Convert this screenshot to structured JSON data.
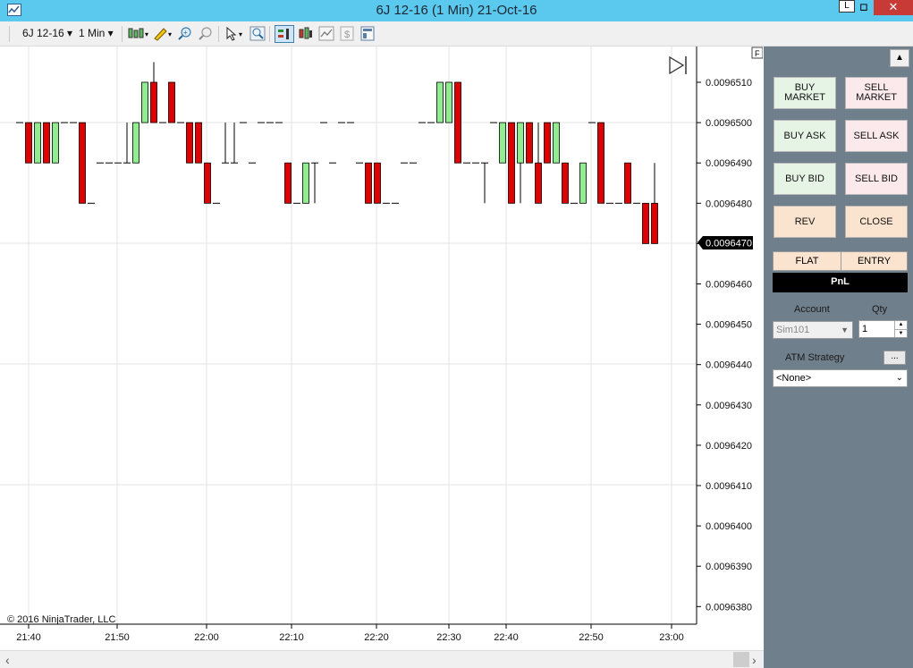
{
  "window": {
    "title": "6J 12-16 (1 Min)  21-Oct-16",
    "l_button": "L",
    "max_button": "◻",
    "close_button": "✕"
  },
  "toolbar": {
    "instrument": "6J 12-16",
    "interval": "1 Min"
  },
  "chart": {
    "copyright": "© 2016 NinjaTrader, LLC",
    "f_button": "F",
    "last_price_label": "0.0096470",
    "price_labels": [
      "0.0096510",
      "0.0096500",
      "0.0096490",
      "0.0096480",
      "0.0096470",
      "0.0096460",
      "0.0096450",
      "0.0096440",
      "0.0096430",
      "0.0096420",
      "0.0096410",
      "0.0096400",
      "0.0096390",
      "0.0096380"
    ],
    "time_labels": [
      "21:40",
      "21:50",
      "22:00",
      "22:10",
      "22:20",
      "22:30",
      "22:40",
      "22:50",
      "23:00"
    ]
  },
  "chart_data": {
    "type": "candlestick",
    "x_start": "21:40",
    "x_end": "23:00",
    "ylim": [
      0.0096378,
      0.0096516
    ],
    "colors": {
      "up": "#90ee90",
      "down": "#e00000",
      "wick": "#000000",
      "grid": "#e3e3e3"
    },
    "candles": [
      [
        "21:39",
        0.00965,
        0.00965,
        0.00965,
        0.00965
      ],
      [
        "21:40",
        0.00965,
        0.00965,
        0.009649,
        0.009649
      ],
      [
        "21:41",
        0.009649,
        0.00965,
        0.009649,
        0.00965
      ],
      [
        "21:42",
        0.00965,
        0.00965,
        0.009649,
        0.009649
      ],
      [
        "21:43",
        0.009649,
        0.00965,
        0.009649,
        0.00965
      ],
      [
        "21:44",
        0.00965,
        0.00965,
        0.00965,
        0.00965
      ],
      [
        "21:45",
        0.00965,
        0.00965,
        0.00965,
        0.00965
      ],
      [
        "21:46",
        0.00965,
        0.00965,
        0.009648,
        0.009648
      ],
      [
        "21:47",
        0.009648,
        0.009648,
        0.009648,
        0.009648
      ],
      [
        "21:48",
        0.009649,
        0.009649,
        0.009649,
        0.009649
      ],
      [
        "21:49",
        0.009649,
        0.009649,
        0.009649,
        0.009649
      ],
      [
        "21:50",
        0.009649,
        0.009649,
        0.009649,
        0.009649
      ],
      [
        "21:51",
        0.009649,
        0.00965,
        0.009649,
        0.009649
      ],
      [
        "21:52",
        0.009649,
        0.00965,
        0.009649,
        0.00965
      ],
      [
        "21:53",
        0.00965,
        0.009651,
        0.00965,
        0.009651
      ],
      [
        "21:54",
        0.009651,
        0.0096515,
        0.00965,
        0.00965
      ],
      [
        "21:55",
        0.00965,
        0.00965,
        0.00965,
        0.00965
      ],
      [
        "21:56",
        0.009651,
        0.009651,
        0.00965,
        0.00965
      ],
      [
        "21:57",
        0.00965,
        0.00965,
        0.00965,
        0.00965
      ],
      [
        "21:58",
        0.00965,
        0.00965,
        0.009649,
        0.009649
      ],
      [
        "21:59",
        0.00965,
        0.00965,
        0.009649,
        0.009649
      ],
      [
        "22:00",
        0.009649,
        0.009649,
        0.009648,
        0.009648
      ],
      [
        "22:01",
        0.009648,
        0.009648,
        0.009648,
        0.009648
      ],
      [
        "22:02",
        0.009649,
        0.00965,
        0.009649,
        0.009649
      ],
      [
        "22:03",
        0.009649,
        0.00965,
        0.009649,
        0.009649
      ],
      [
        "22:04",
        0.00965,
        0.00965,
        0.00965,
        0.00965
      ],
      [
        "22:05",
        0.009649,
        0.009649,
        0.009649,
        0.009649
      ],
      [
        "22:06",
        0.00965,
        0.00965,
        0.00965,
        0.00965
      ],
      [
        "22:07",
        0.00965,
        0.00965,
        0.00965,
        0.00965
      ],
      [
        "22:08",
        0.00965,
        0.00965,
        0.00965,
        0.00965
      ],
      [
        "22:09",
        0.009649,
        0.009649,
        0.009648,
        0.009648
      ],
      [
        "22:10",
        0.009648,
        0.009648,
        0.009648,
        0.009648
      ],
      [
        "22:11",
        0.009648,
        0.009649,
        0.009648,
        0.009649
      ],
      [
        "22:12",
        0.009649,
        0.009649,
        0.009648,
        0.009649
      ],
      [
        "22:13",
        0.00965,
        0.00965,
        0.00965,
        0.00965
      ],
      [
        "22:14",
        0.009649,
        0.009649,
        0.009649,
        0.009649
      ],
      [
        "22:15",
        0.00965,
        0.00965,
        0.00965,
        0.00965
      ],
      [
        "22:16",
        0.00965,
        0.00965,
        0.00965,
        0.00965
      ],
      [
        "22:17",
        0.009649,
        0.009649,
        0.009649,
        0.009649
      ],
      [
        "22:18",
        0.009649,
        0.009649,
        0.009648,
        0.009648
      ],
      [
        "22:19",
        0.009649,
        0.009649,
        0.009648,
        0.009648
      ],
      [
        "22:20",
        0.009648,
        0.009648,
        0.009648,
        0.009648
      ],
      [
        "22:21",
        0.009648,
        0.009648,
        0.009648,
        0.009648
      ],
      [
        "22:22",
        0.009649,
        0.009649,
        0.009649,
        0.009649
      ],
      [
        "22:23",
        0.009649,
        0.009649,
        0.009649,
        0.009649
      ],
      [
        "22:24",
        0.00965,
        0.00965,
        0.00965,
        0.00965
      ],
      [
        "22:25",
        0.00965,
        0.00965,
        0.00965,
        0.00965
      ],
      [
        "22:26",
        0.00965,
        0.009651,
        0.00965,
        0.009651
      ],
      [
        "22:27",
        0.00965,
        0.009651,
        0.00965,
        0.009651
      ],
      [
        "22:28",
        0.009651,
        0.009651,
        0.009649,
        0.009649
      ],
      [
        "22:29",
        0.009649,
        0.009649,
        0.009649,
        0.009649
      ],
      [
        "22:30",
        0.009649,
        0.009649,
        0.009649,
        0.009649
      ],
      [
        "22:31",
        0.009649,
        0.009649,
        0.009648,
        0.009649
      ],
      [
        "22:32",
        0.00965,
        0.00965,
        0.00965,
        0.00965
      ],
      [
        "22:33",
        0.009649,
        0.00965,
        0.009649,
        0.00965
      ],
      [
        "22:34",
        0.00965,
        0.00965,
        0.009648,
        0.009648
      ],
      [
        "22:35",
        0.009649,
        0.00965,
        0.009648,
        0.00965
      ],
      [
        "22:36",
        0.00965,
        0.00965,
        0.009649,
        0.009649
      ],
      [
        "22:37",
        0.009649,
        0.00965,
        0.009648,
        0.009648
      ],
      [
        "22:38",
        0.00965,
        0.00965,
        0.009649,
        0.009649
      ],
      [
        "22:39",
        0.009649,
        0.00965,
        0.009649,
        0.00965
      ],
      [
        "22:40",
        0.009649,
        0.009649,
        0.009648,
        0.009648
      ],
      [
        "22:41",
        0.009648,
        0.009648,
        0.009648,
        0.009648
      ],
      [
        "22:42",
        0.009648,
        0.009649,
        0.009648,
        0.009649
      ],
      [
        "22:43",
        0.00965,
        0.00965,
        0.00965,
        0.00965
      ],
      [
        "22:44",
        0.00965,
        0.00965,
        0.009648,
        0.009648
      ],
      [
        "22:45",
        0.009648,
        0.009648,
        0.009648,
        0.009648
      ],
      [
        "22:46",
        0.009648,
        0.009648,
        0.009648,
        0.009648
      ],
      [
        "22:47",
        0.009649,
        0.009649,
        0.009648,
        0.009648
      ],
      [
        "22:48",
        0.009648,
        0.009648,
        0.009648,
        0.009648
      ],
      [
        "22:49",
        0.009648,
        0.009648,
        0.009647,
        0.009647
      ],
      [
        "22:50",
        0.009648,
        0.009649,
        0.009647,
        0.009647
      ]
    ]
  },
  "panel": {
    "buy_market": "BUY MARKET",
    "sell_market": "SELL MARKET",
    "buy_ask": "BUY ASK",
    "sell_ask": "SELL ASK",
    "buy_bid": "BUY BID",
    "sell_bid": "SELL BID",
    "rev": "REV",
    "close": "CLOSE",
    "flat": "FLAT",
    "entry": "ENTRY",
    "pnl": "PnL",
    "account_label": "Account",
    "qty_label": "Qty",
    "account_value": "Sim101",
    "qty_value": "1",
    "atm_label": "ATM Strategy",
    "atm_button": "...",
    "atm_value": "<None>"
  }
}
